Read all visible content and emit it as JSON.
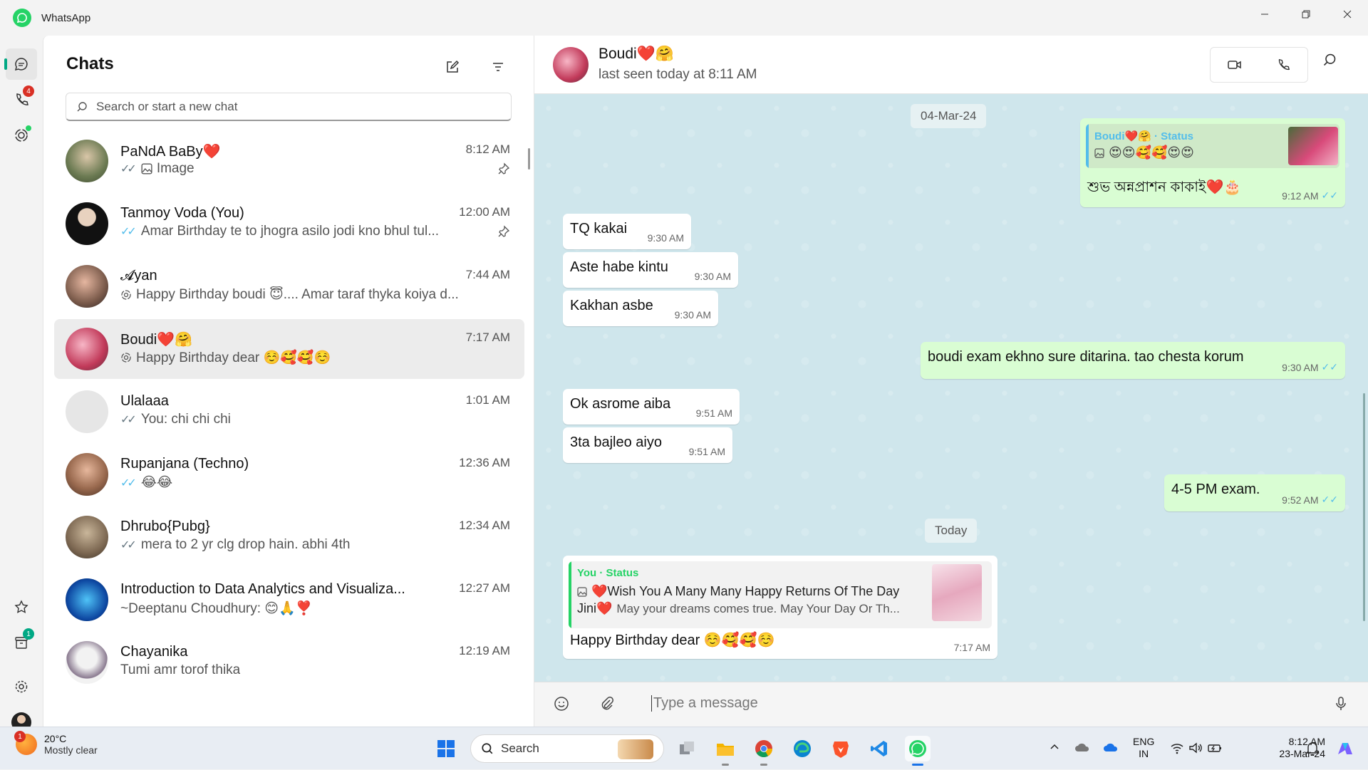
{
  "window": {
    "title": "WhatsApp"
  },
  "rail": {
    "calls_badge": "4",
    "archive_badge": "1"
  },
  "list": {
    "heading": "Chats",
    "search_placeholder": "Search or start a new chat",
    "chats": [
      {
        "name": "PaNdA BaBy❤️",
        "time": "8:12 AM",
        "preview": "Image",
        "pinned": true,
        "ticks": "✓✓",
        "ticks_color": "#667781"
      },
      {
        "name": "Tanmoy Voda (You)",
        "time": "12:00 AM",
        "preview": "Amar Birthday te to jhogra asilo jodi kno bhul tul...",
        "pinned": true,
        "ticks": "✓✓",
        "ticks_color": "#53bdeb"
      },
      {
        "name": "𝓐yan",
        "time": "7:44 AM",
        "preview": "Happy Birthday boudi 😇.... Amar taraf thyka koiya d...",
        "pinned": false,
        "ticks": "",
        "ticks_color": "#667781"
      },
      {
        "name": "Boudi❤️🤗",
        "time": "7:17 AM",
        "preview": "Happy Birthday dear ☺️🥰🥰☺️",
        "pinned": false,
        "ticks": "",
        "ticks_color": "#667781"
      },
      {
        "name": "Ulalaaa",
        "time": "1:01 AM",
        "preview": "You: chi chi chi",
        "pinned": false,
        "ticks": "✓✓",
        "ticks_color": "#667781"
      },
      {
        "name": "Rupanjana (Techno)",
        "time": "12:36 AM",
        "preview": "😂😂",
        "pinned": false,
        "ticks": "✓✓",
        "ticks_color": "#53bdeb"
      },
      {
        "name": "Dhrubo{Pubg}",
        "time": "12:34 AM",
        "preview": "mera to 2 yr clg drop hain. abhi 4th",
        "pinned": false,
        "ticks": "✓✓",
        "ticks_color": "#667781"
      },
      {
        "name": "Introduction to Data Analytics and Visualiza...",
        "time": "12:27 AM",
        "preview": "~Deeptanu Choudhury: 😊🙏❣️",
        "pinned": false,
        "ticks": "",
        "ticks_color": "#667781"
      },
      {
        "name": "Chayanika",
        "time": "12:19 AM",
        "preview": "Tumi amr torof thika",
        "pinned": false,
        "ticks": "",
        "ticks_color": "#667781"
      }
    ]
  },
  "chat": {
    "name": "Boudi❤️🤗",
    "status": "last seen today at 8:11 AM",
    "date1": "04-Mar-24",
    "date2": "Today",
    "status_reply": {
      "author": "Boudi❤️🤗 · Status",
      "text": "😍😍🥰🥰😍😍",
      "message": "শুভ অন্নপ্রাশন কাকাই❤️🎂",
      "time": "9:12 AM"
    },
    "messages": [
      {
        "text": "TQ kakai",
        "time": "9:30 AM"
      },
      {
        "text": "Aste habe kintu",
        "time": "9:30 AM"
      },
      {
        "text": "Kakhan asbe",
        "time": "9:30 AM"
      },
      {
        "text": "boudi exam ekhno sure ditarina. tao chesta korum",
        "time": "9:30 AM"
      },
      {
        "text": "Ok asrome aiba",
        "time": "9:51 AM"
      },
      {
        "text": "3ta bajleo aiyo",
        "time": "9:51 AM"
      },
      {
        "text": "4-5 PM exam.",
        "time": "9:52 AM"
      }
    ],
    "last_reply": {
      "author": "You · Status",
      "line1": "❤️Wish You A Many Many Happy Returns Of The Day",
      "line2_name": "Jini❤️",
      "line2_rest": "May your dreams comes true. May Your Day Or Th...",
      "message": "Happy Birthday dear ☺️🥰🥰☺️",
      "time": "7:17 AM"
    },
    "composer_placeholder": "Type a message"
  },
  "taskbar": {
    "weather_badge": "1",
    "temp": "20°C",
    "condition": "Mostly clear",
    "search": "Search",
    "lang1": "ENG",
    "lang2": "IN",
    "clock_time": "8:12 AM",
    "clock_date": "23-Mar-24"
  },
  "colors": {
    "accent": "#00a884",
    "read_ticks": "#53bdeb",
    "status_author": "#53bdeb",
    "you_author": "#25d366",
    "badge": "#d93025"
  }
}
